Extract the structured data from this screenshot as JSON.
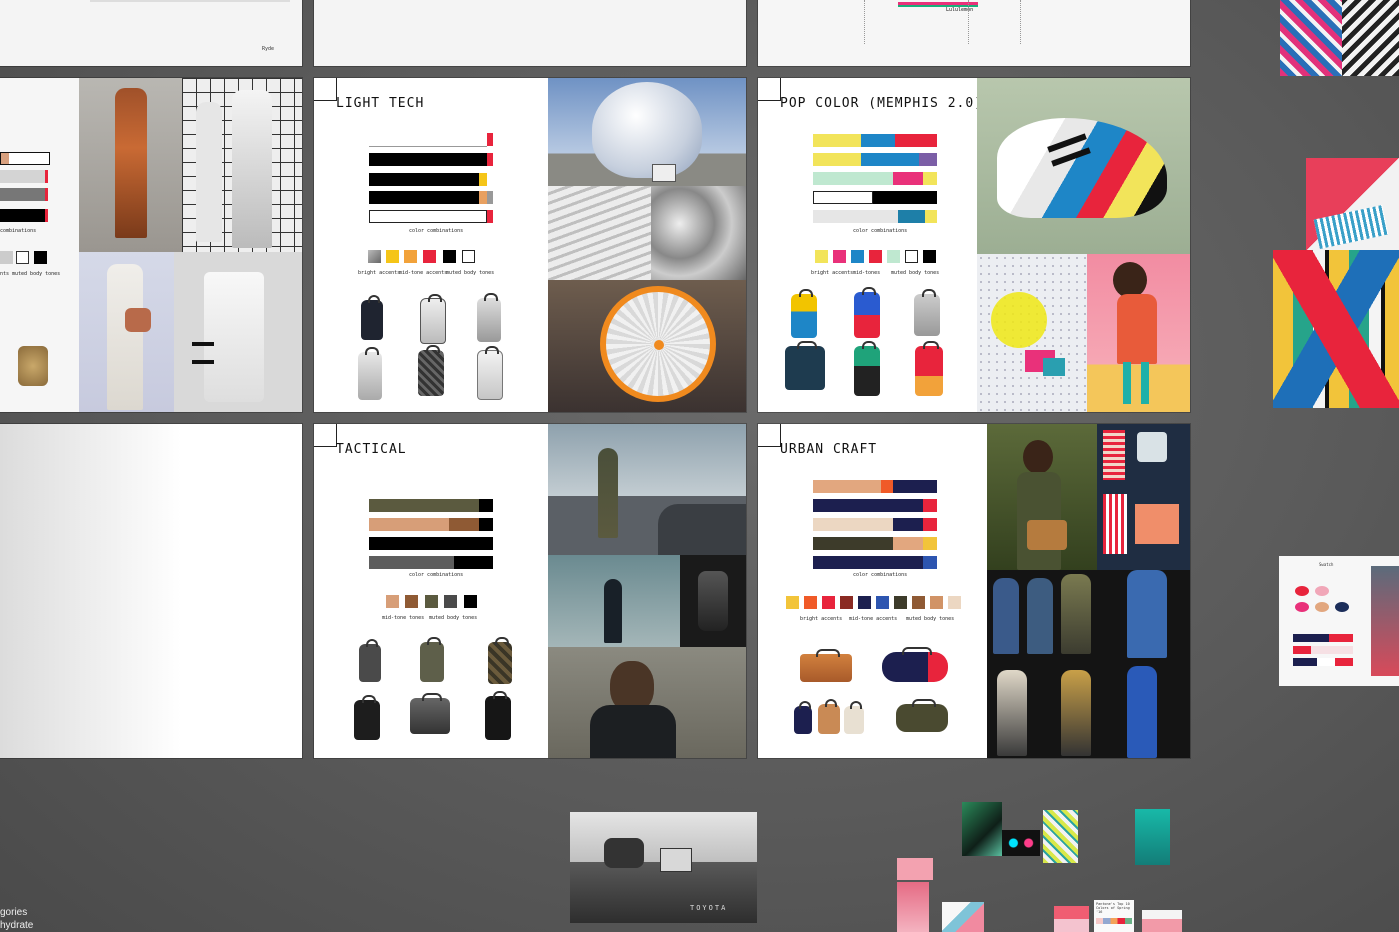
{
  "boards": {
    "light_tech": {
      "title": "LIGHT TECH",
      "combos_caption": "color combinations",
      "labels": [
        "bright accents",
        "mid-tone accents",
        "muted body tones"
      ]
    },
    "pop_color": {
      "title": "POP COLOR (MEMPHIS 2.0)",
      "combos_caption": "color combinations",
      "labels": [
        "bright accents",
        "mid-tones",
        "muted body tones"
      ]
    },
    "tactical": {
      "title": "TACTICAL",
      "combos_caption": "color combinations",
      "labels": [
        "mid-tone tones",
        "muted body tones"
      ]
    },
    "urban_craft": {
      "title": "URBAN CRAFT",
      "combos_caption": "color combinations",
      "labels": [
        "bright accents",
        "mid-tone accents",
        "muted body tones"
      ]
    },
    "left_partial": {
      "caption": "combinations",
      "labels": [
        "nts",
        "muted body tones"
      ]
    },
    "top_partial": {
      "brand": "Lululemon",
      "logo": "Ryde"
    }
  },
  "thumbnails": {
    "pantone": "Pantone's Top 10 Colors of Spring '16",
    "swatch_page": "Swatch"
  },
  "side_text": [
    "gories",
    "hydrate"
  ],
  "truck_brand": "TOYOTA",
  "colors": {
    "canvas": "#5a5a5a",
    "accent_red": "#e8243c",
    "memphis_yellow": "#f2e45a",
    "memphis_blue": "#1e86c7",
    "memphis_pink": "#e9317a",
    "tactical_olive": "#5b5a3f",
    "tactical_tan": "#d79e78",
    "urban_navy": "#1c1f4f",
    "urban_peach": "#e2a77f"
  }
}
